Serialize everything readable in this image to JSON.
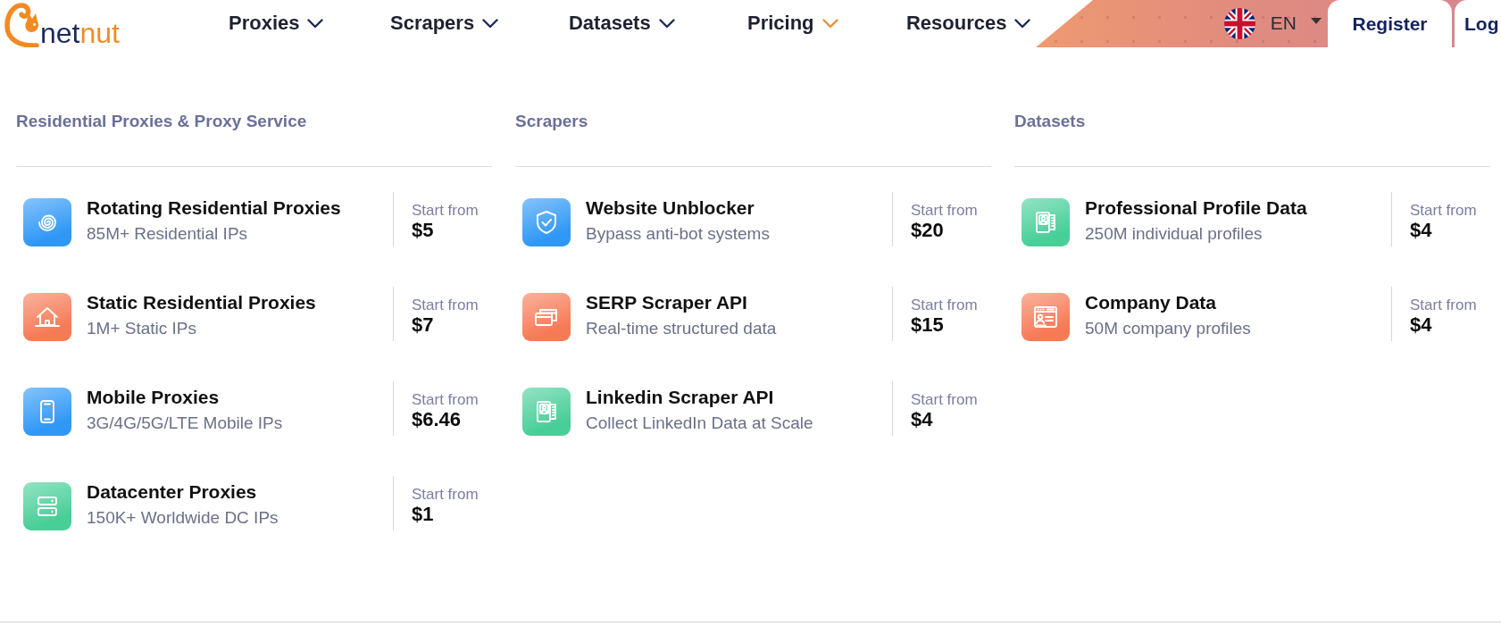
{
  "header": {
    "logo": {
      "text": "netnut"
    },
    "nav": [
      {
        "label": "Proxies",
        "expanded": false
      },
      {
        "label": "Scrapers",
        "expanded": false
      },
      {
        "label": "Datasets",
        "expanded": false
      },
      {
        "label": "Pricing",
        "expanded": true
      },
      {
        "label": "Resources",
        "expanded": false
      }
    ],
    "language": {
      "label": "EN"
    },
    "buttons": [
      {
        "label": "Register"
      },
      {
        "label": "Log"
      }
    ]
  },
  "menu": {
    "columns": [
      {
        "title": "Residential Proxies & Proxy Service",
        "items": [
          {
            "title": "Rotating Residential Proxies",
            "subtitle": "85M+ Residential IPs",
            "price_label": "Start from",
            "price": "$5",
            "color": "#2f98f7"
          },
          {
            "title": "Static Residential Proxies",
            "subtitle": "1M+ Static IPs",
            "price_label": "Start from",
            "price": "$7",
            "color": "#f77a56"
          },
          {
            "title": "Mobile Proxies",
            "subtitle": "3G/4G/5G/LTE Mobile IPs",
            "price_label": "Start from",
            "price": "$6.46",
            "color": "#2f98f7"
          },
          {
            "title": "Datacenter Proxies",
            "subtitle": "150K+ Worldwide DC IPs",
            "price_label": "Start from",
            "price": "$1",
            "color": "#48cf98"
          }
        ]
      },
      {
        "title": "Scrapers",
        "items": [
          {
            "title": "Website Unblocker",
            "subtitle": "Bypass anti-bot systems",
            "price_label": "Start from",
            "price": "$20",
            "color": "#2f98f7"
          },
          {
            "title": "SERP Scraper API",
            "subtitle": "Real-time structured data",
            "price_label": "Start from",
            "price": "$15",
            "color": "#f77a56"
          },
          {
            "title": "Linkedin Scraper API",
            "subtitle": "Collect LinkedIn Data at Scale",
            "price_label": "Start from",
            "price": "$4",
            "color": "#48cf98"
          }
        ]
      },
      {
        "title": "Datasets",
        "items": [
          {
            "title": "Professional Profile Data",
            "subtitle": "250M individual profiles",
            "price_label": "Start from",
            "price": "$4",
            "color": "#48cf98"
          },
          {
            "title": "Company Data",
            "subtitle": "50M company profiles",
            "price_label": "Start from",
            "price": "$4",
            "color": "#f77a56"
          }
        ]
      }
    ]
  }
}
